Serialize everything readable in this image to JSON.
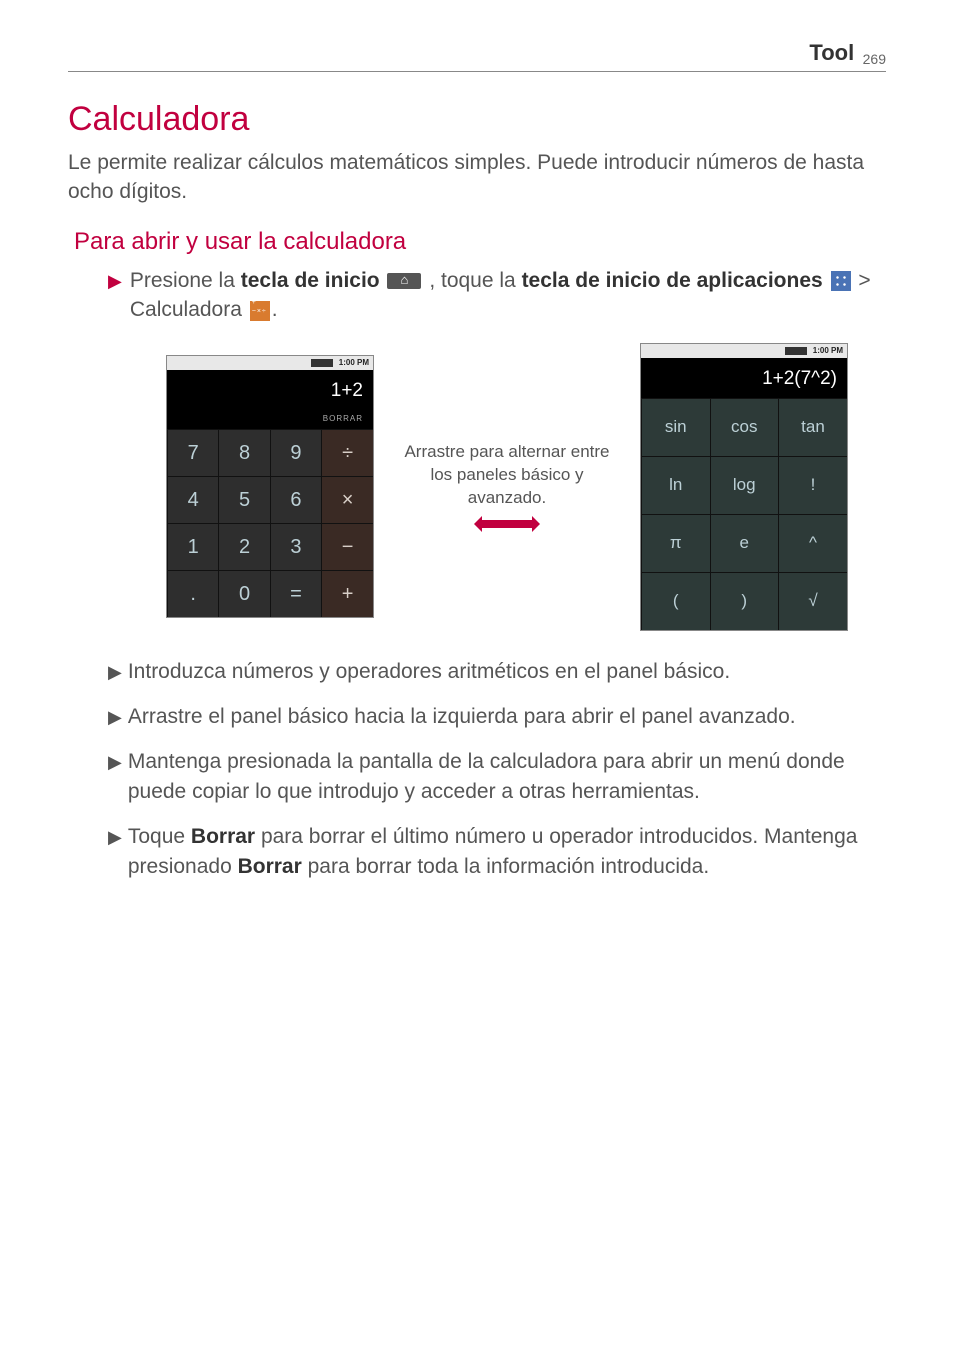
{
  "header": {
    "section": "Tool",
    "page_number": "269"
  },
  "title": "Calculadora",
  "intro": "Le permite realizar cálculos matemáticos simples. Puede introducir números de hasta ocho dígitos.",
  "subtitle": "Para abrir y usar la calculadora",
  "step1": {
    "pre": "Presione la ",
    "b1": "tecla de inicio",
    "mid": " , toque la ",
    "b2": "tecla de inicio de aplicaciones",
    "mid2": " > Calculadora ",
    "end": "."
  },
  "figure": {
    "status_time": "1:00 PM",
    "basic_display": "1+2",
    "borrar": "BORRAR",
    "basic_keys": [
      [
        "7",
        "8",
        "9",
        "÷"
      ],
      [
        "4",
        "5",
        "6",
        "×"
      ],
      [
        "1",
        "2",
        "3",
        "−"
      ],
      [
        ".",
        "0",
        "=",
        "+"
      ]
    ],
    "adv_display": "1+2(7^2)",
    "adv_keys": [
      [
        "sin",
        "cos",
        "tan"
      ],
      [
        "ln",
        "log",
        "!"
      ],
      [
        "π",
        "e",
        "^"
      ],
      [
        "(",
        ")",
        "√"
      ]
    ],
    "swipe_caption": "Arrastre para alternar entre los paneles básico y avanzado."
  },
  "bullets": [
    "Introduzca números y operadores aritméticos en el panel básico.",
    "Arrastre el panel básico hacia la izquierda para abrir el panel avanzado.",
    "Mantenga presionada la pantalla de la calculadora para abrir un menú donde puede copiar lo que introdujo y acceder a otras herramientas."
  ],
  "bullet4": {
    "pre": "Toque ",
    "b1": "Borrar",
    "mid": " para borrar el último número u operador introducidos. Mantenga presionado ",
    "b2": "Borrar",
    "end": " para borrar toda la información introducida."
  }
}
